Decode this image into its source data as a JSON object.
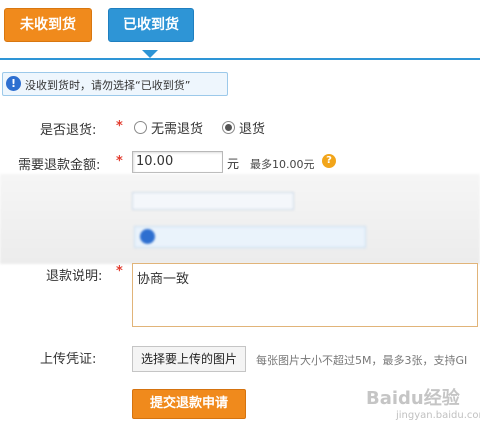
{
  "tabs": {
    "not_received": "未收到货",
    "received": "已收到货"
  },
  "notice": {
    "icon": "!",
    "text": "没收到货时，请勿选择“已收到货”"
  },
  "form": {
    "return_label": "是否退货:",
    "return_options": [
      "无需退货",
      "退货"
    ],
    "amount_label": "需要退款金额:",
    "amount_value": "10.00",
    "amount_unit": "元",
    "amount_max": "最多10.00元",
    "help_icon": "?",
    "star": "*",
    "explain_label": "退款说明:",
    "explain_value": "协商一致",
    "upload_label": "上传凭证:",
    "upload_button": "选择要上传的图片",
    "upload_hint": "每张图片大小不超过5M，最多3张，支持GI",
    "submit": "提交退款申请"
  },
  "watermark": {
    "text": "Baidu经验",
    "sub": "jingyan.baidu.com"
  },
  "colors": {
    "orange": "#f08a1c",
    "blue": "#2e95d6"
  }
}
